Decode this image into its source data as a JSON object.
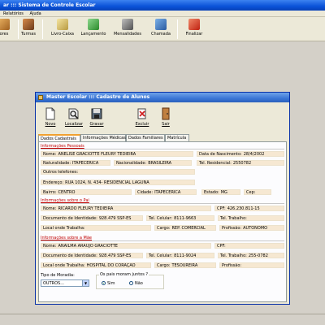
{
  "main": {
    "title": "ar ::: Sistema de Controle Escolar",
    "menu": [
      "Relatórios",
      "Ajuda"
    ],
    "toolbar": [
      "ores",
      "Turmas",
      "Livro-Caixa",
      "Lançamento",
      "Mensalidades",
      "Chamada",
      "Finalizar"
    ]
  },
  "window": {
    "title": "Master Escolar ::: Cadastro de Alunos",
    "toolbar": [
      "Novo",
      "Localizar",
      "Gravar",
      "Excluir",
      "Sair"
    ],
    "tabs": [
      "Dados Cadastrais",
      "Informações Médicas",
      "Dados Familiares",
      "Matrícula"
    ]
  },
  "form": {
    "sections": {
      "pessoais": "Informações Pessoais",
      "pai": "Informações sobre o Pai",
      "mae": "Informações sobre a Mãe"
    },
    "labels": {
      "nome": "Nome:",
      "data_nascimento": "Data de Nascimento:",
      "naturalidade": "Naturalidade:",
      "nacionalidade": "Nacionalidade:",
      "tel_residencial": "Tel. Residencial:",
      "outros_telefones": "Outros telefones:",
      "endereco": "Endereço:",
      "bairro": "Bairro:",
      "cidade": "Cidade:",
      "estado": "Estado:",
      "cep": "Cep:",
      "cpf": "CPF:",
      "documento": "Documento de Identidade:",
      "tel_celular": "Tel. Celular:",
      "tel_trabalho": "Tel. Trabalho:",
      "local_trabalho": "Local onde Trabalha:",
      "cargo": "Cargo:",
      "profissao": "Profissão:",
      "tipo_moradia": "Tipo de Moradia:",
      "pais_juntos": "Os pais moram juntos ?",
      "sim": "Sim",
      "nao": "Não"
    },
    "aluno": {
      "nome": "ANELISE GRACIOTTE FLEURY TEDIEIRA",
      "data_nascimento": "28/4/2002",
      "naturalidade": "ITAPECERICA",
      "nacionalidade": "BRASILEIRA",
      "tel_residencial": "2550782",
      "outros_telefones": "",
      "endereco": "RUA 1024, N. 434- RESIDENCIAL LAGUNA",
      "bairro": "CENTRO",
      "cidade": "ITAPECERICA",
      "estado": "MG",
      "cep": ""
    },
    "pai": {
      "nome": "RICARDO FLEURY TEDIEIRA",
      "cpf": "426.230.811-15",
      "documento": "928.479 SSP-ES",
      "tel_celular": "8111-9663",
      "tel_trabalho": "",
      "local_trabalho": "",
      "cargo": "REP. COMERCIAL",
      "profissao": "AUTÔNOMO"
    },
    "mae": {
      "nome": "ANAILMA ARAUJO GRACIOTTE",
      "cpf": "",
      "documento": "928.479 SSP-ES",
      "tel_celular": "8111-9024",
      "tel_trabalho": "255-0782",
      "local_trabalho": "HOSPITAL DO CORAÇÃO",
      "cargo": "TESOUREIRA",
      "profissao": ""
    },
    "tipo_moradia": "OUTROS...",
    "pais_juntos_selected": "Sim"
  },
  "colors": {
    "title_blue": "#0a52d8",
    "section_red": "#c00000",
    "field_bg": "#f6e8d2"
  },
  "icons": {
    "toolbar": [
      "users-icon",
      "users-group-icon",
      "cash-book-icon",
      "check-icon",
      "book-icon",
      "calendar-icon",
      "exit-icon"
    ],
    "window_toolbar": [
      "new-page-icon",
      "search-icon",
      "save-icon",
      "delete-icon",
      "exit-door-icon"
    ]
  }
}
